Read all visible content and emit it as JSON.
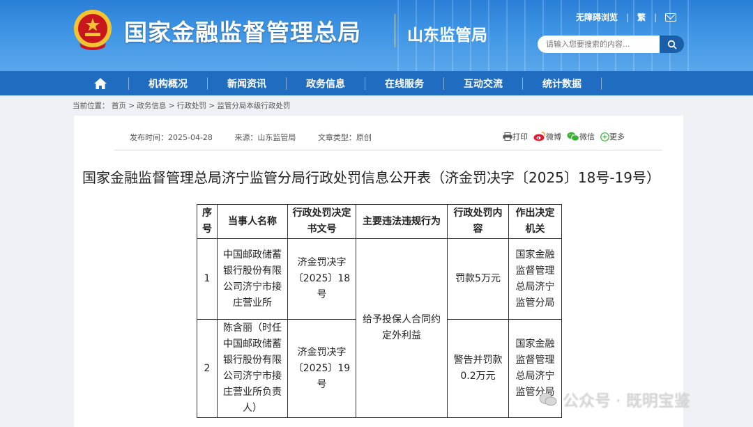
{
  "header": {
    "site_title": "国家金融监督管理总局",
    "branch_name": "山东监管局",
    "links": [
      "无障碍浏览",
      "繁"
    ],
    "search_placeholder": "请输入您要搜索的内容...",
    "icons": [
      "national-emblem-icon",
      "mail-icon",
      "search-icon"
    ]
  },
  "nav": {
    "home_icon": "home-icon",
    "items": [
      "机构概况",
      "新闻资讯",
      "政务信息",
      "在线服务",
      "互动交流",
      "统计数据"
    ]
  },
  "breadcrumb": {
    "prefix": "当前位置：",
    "items": [
      "首页",
      "政务信息",
      "行政处罚",
      "监管分局本级行政处罚"
    ],
    "separator": ">"
  },
  "article": {
    "publish_time": "发布时间：2025-04-28",
    "source": "来源：山东监管局",
    "doc_type": "文章类型：原创",
    "share": [
      "打印",
      "微博",
      "微信",
      "更多"
    ],
    "title": "国家金融监督管理总局济宁监管分局行政处罚信息公开表（济金罚决字〔2025〕18号-19号）"
  },
  "table": {
    "headers": [
      "序号",
      "当事人名称",
      "行政处罚决定书文号",
      "主要违法违规行为",
      "行政处罚内容",
      "作出决定机关"
    ],
    "rows": [
      {
        "no": "1",
        "party": "中国邮政储蓄银行股份有限公司济宁市接庄营业所",
        "doc_no": "济金罚决字〔2025〕18号",
        "penalty": "罚款5万元",
        "authority": "国家金融监督管理总局济宁监管分局"
      },
      {
        "no": "2",
        "party": "陈含丽（时任中国邮政储蓄银行股份有限公司济宁市接庄营业所负责人）",
        "doc_no": "济金罚决字〔2025〕19号",
        "penalty": "警告并罚款0.2万元",
        "authority": "国家金融监督管理总局济宁监管分局"
      }
    ],
    "shared_violation": "给予投保人合同约定外利益"
  },
  "watermark": "公众号 · 既明宝鉴",
  "colors": {
    "header_blue": "#3a8ee0",
    "nav_blue": "#1f6cc0",
    "search_button": "#1b5fa8",
    "emblem_red": "#c8161d",
    "emblem_gold": "#f4c430"
  }
}
